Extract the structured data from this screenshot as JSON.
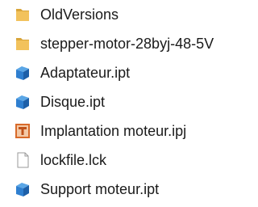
{
  "files": [
    {
      "name": "OldVersions",
      "icon": "folder-icon",
      "type": "folder"
    },
    {
      "name": "stepper-motor-28byj-48-5V",
      "icon": "folder-icon",
      "type": "folder"
    },
    {
      "name": "Adaptateur.ipt",
      "icon": "inventor-part-icon",
      "type": "ipt"
    },
    {
      "name": "Disque.ipt",
      "icon": "inventor-part-icon",
      "type": "ipt"
    },
    {
      "name": "Implantation moteur.ipj",
      "icon": "inventor-project-icon",
      "type": "ipj"
    },
    {
      "name": "lockfile.lck",
      "icon": "blank-document-icon",
      "type": "lck"
    },
    {
      "name": "Support moteur.ipt",
      "icon": "inventor-part-icon",
      "type": "ipt"
    }
  ],
  "colors": {
    "folder": "#f2c25c",
    "folder_dark": "#d9a53a",
    "part_top": "#5aa6e6",
    "part_front": "#2f7fd0",
    "part_side": "#1d5fa8",
    "project": "#d86a2a"
  }
}
